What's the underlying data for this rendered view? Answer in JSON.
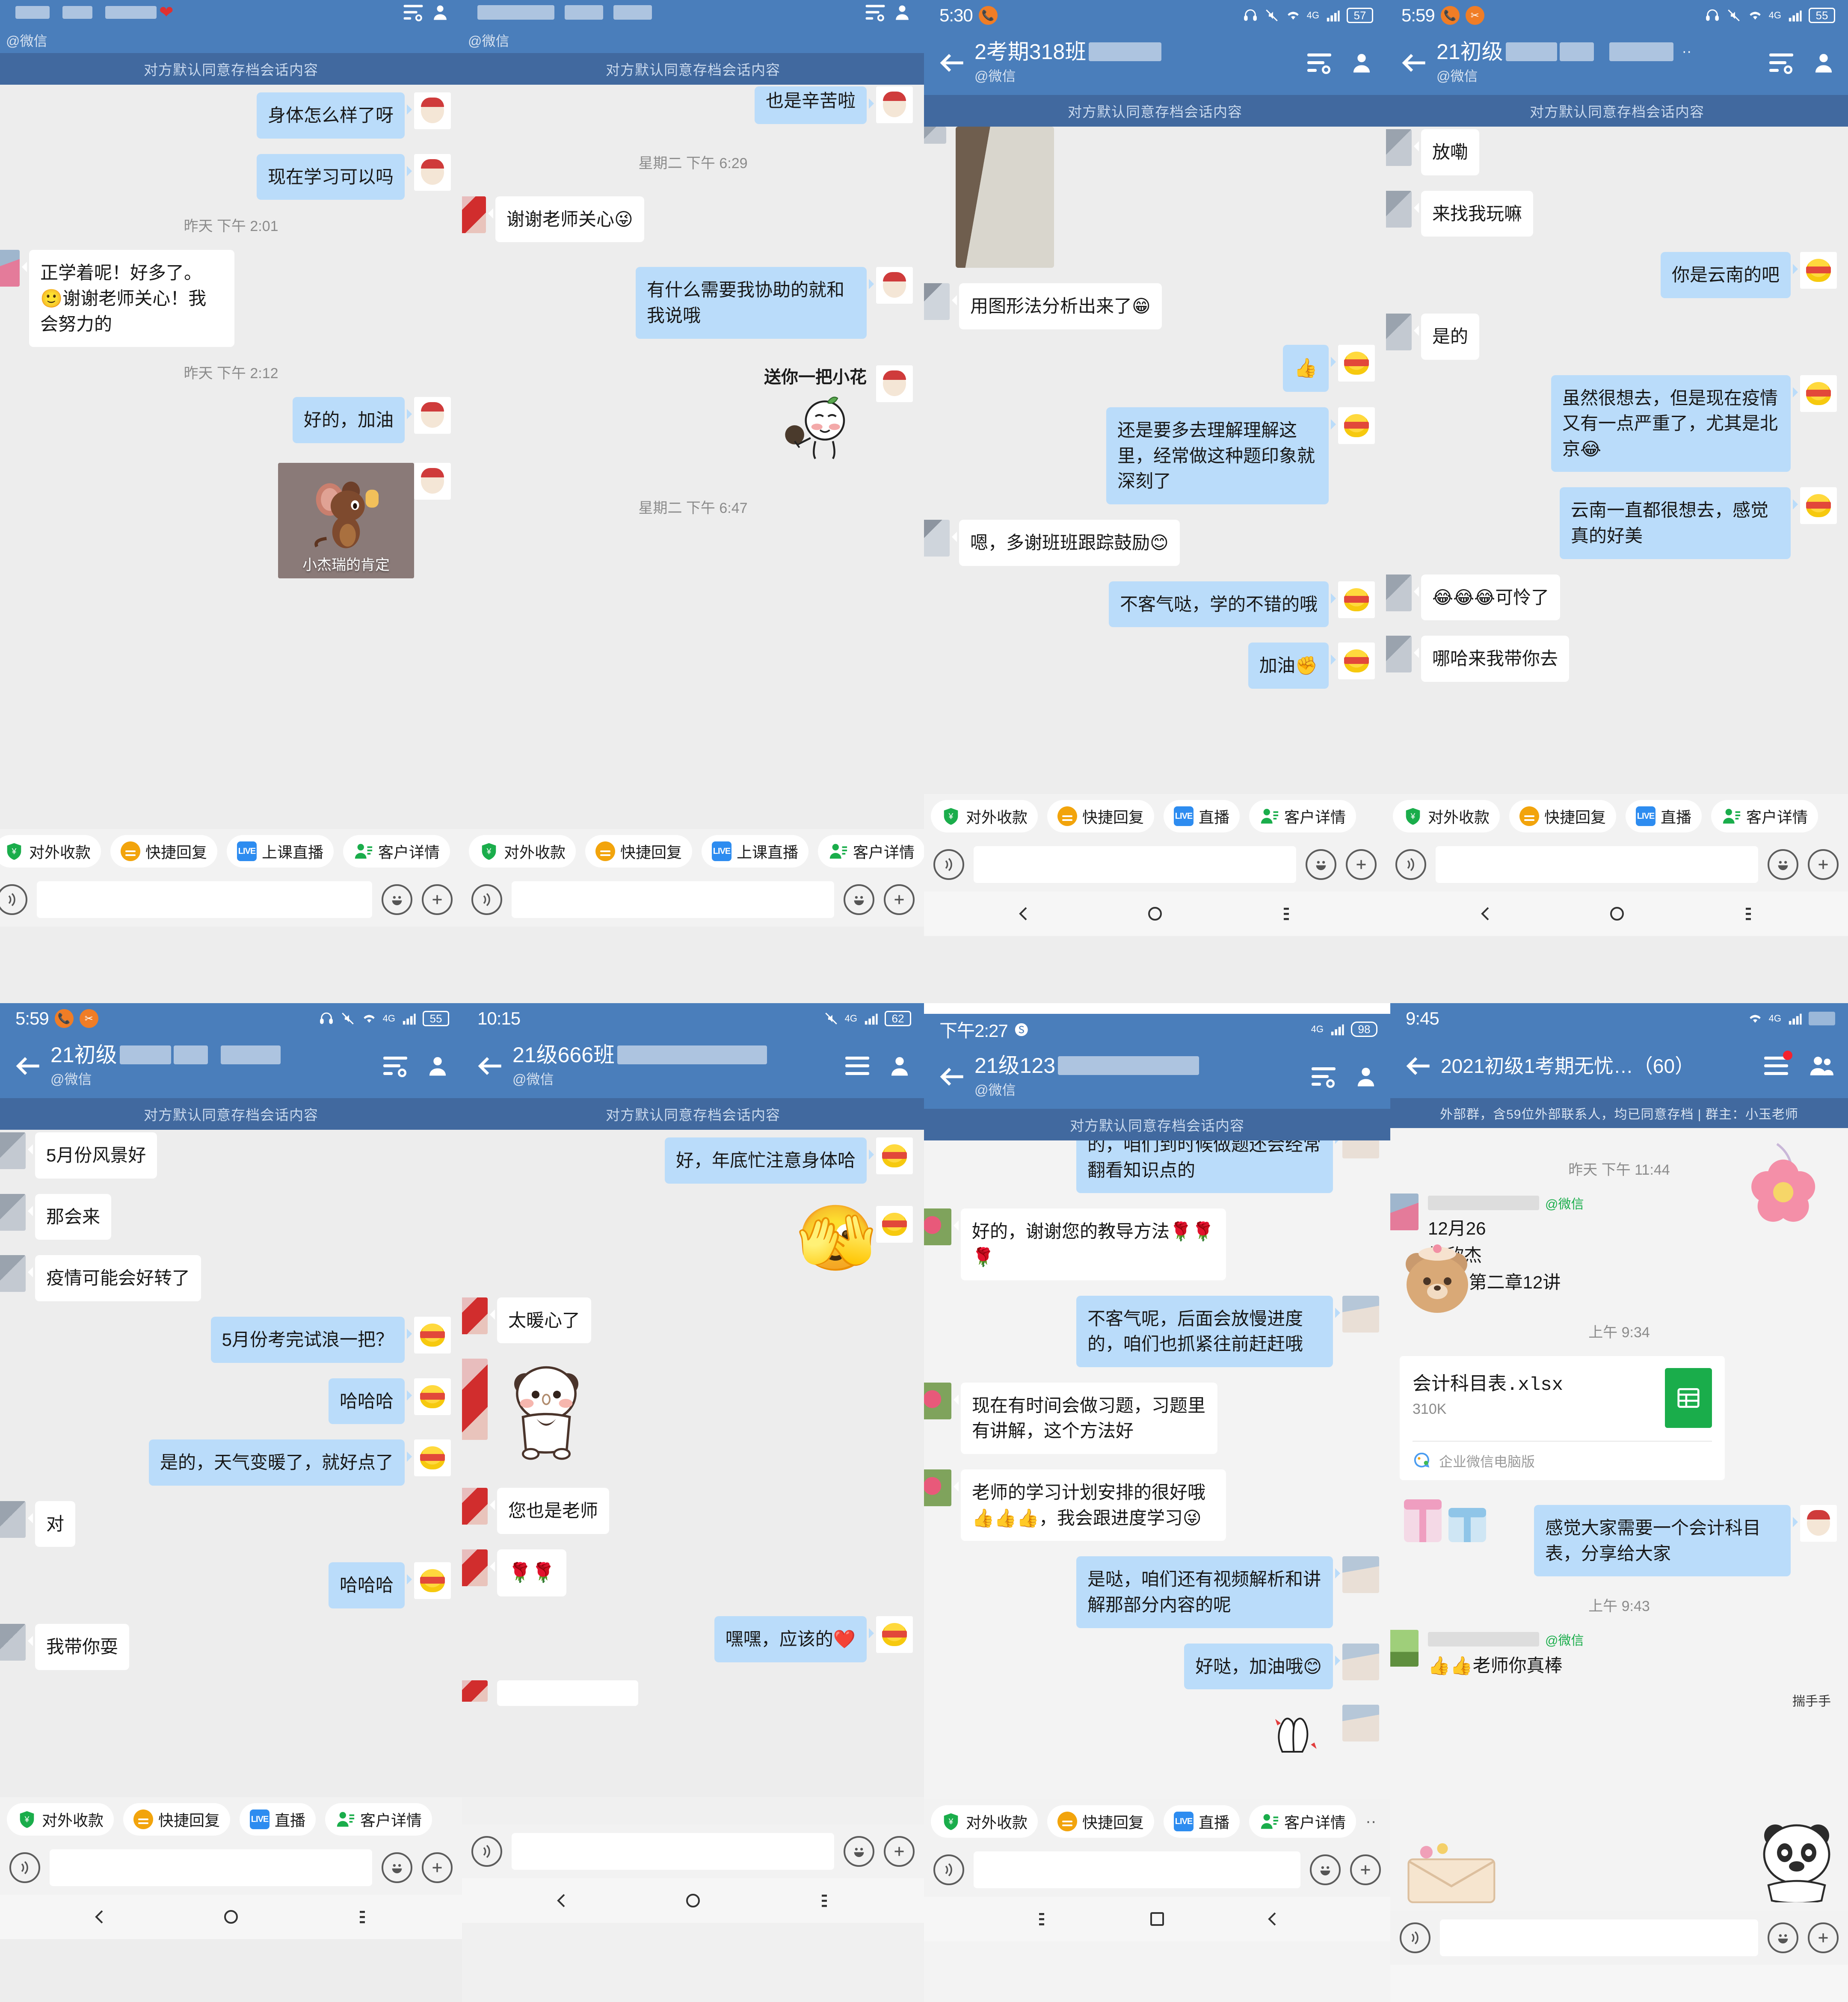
{
  "app": {
    "archive_notice": "对方默认同意存档会话内容",
    "wechat_handle": "@微信",
    "colors": {
      "header": "#4a7ebb",
      "archive_bar": "#41699f",
      "bubble_out": "#badcfa",
      "bubble_in": "#ffffff",
      "chat_bg": "#ededed"
    }
  },
  "quickbar": {
    "pay": "对外收款",
    "quick_reply": "快捷回复",
    "live_class": "上课直播",
    "live": "直播",
    "customer": "客户详情",
    "more": "··"
  },
  "panels": [
    {
      "id": "panel-1",
      "status": {
        "clock": "",
        "battery": "",
        "badges": []
      },
      "title": "",
      "subtitle": "@微信",
      "messages": [
        {
          "side": "out",
          "type": "text",
          "text": "身体怎么样了呀",
          "avatar": "doll"
        },
        {
          "side": "out",
          "type": "text",
          "text": "现在学习可以吗",
          "avatar": "doll"
        },
        {
          "type": "time",
          "text": "昨天  下午 2:01"
        },
        {
          "side": "in",
          "type": "text",
          "text": "正学着呢！好多了。🙂谢谢老师关心！我会努力的",
          "avatar": "photo"
        },
        {
          "type": "time",
          "text": "昨天  下午 2:12"
        },
        {
          "side": "out",
          "type": "text",
          "text": "好的，加油",
          "avatar": "doll"
        },
        {
          "side": "out",
          "type": "meme",
          "text": "小杰瑞的肯定",
          "avatar": "doll"
        }
      ],
      "quick": [
        "pay",
        "quick_reply",
        "live_class",
        "customer"
      ]
    },
    {
      "id": "panel-2",
      "status": {
        "clock": "",
        "battery": "",
        "badges": []
      },
      "title": "",
      "subtitle": "@微信",
      "messages": [
        {
          "side": "out",
          "type": "text",
          "text": "也是辛苦啦",
          "avatar": "doll"
        },
        {
          "type": "time",
          "text": "星期二  下午 6:29"
        },
        {
          "side": "in",
          "type": "text",
          "text": "谢谢老师关心😜",
          "avatar": "redblur"
        },
        {
          "side": "out",
          "type": "text",
          "text": "有什么需要我协助的就和我说哦",
          "avatar": "doll"
        },
        {
          "side": "out",
          "type": "sticker",
          "text": "送你一把小花",
          "avatar": "doll"
        },
        {
          "type": "time",
          "text": "星期二  下午 6:47"
        }
      ],
      "quick": [
        "pay",
        "quick_reply",
        "live_class",
        "customer"
      ]
    },
    {
      "id": "panel-3",
      "status": {
        "clock": "5:30",
        "battery": "57",
        "badges": [
          "call"
        ]
      },
      "title": "2考期318班",
      "subtitle": "@微信",
      "messages": [
        {
          "side": "in",
          "type": "image",
          "text": "",
          "avatar": "blur"
        },
        {
          "side": "in",
          "type": "text",
          "text": "用图形法分析出来了😁",
          "avatar": "blur2"
        },
        {
          "side": "out",
          "type": "emoji",
          "text": "👍",
          "avatar": "bee"
        },
        {
          "side": "out",
          "type": "text",
          "text": "还是要多去理解理解这里，经常做这种题印象就深刻了",
          "avatar": "bee"
        },
        {
          "side": "in",
          "type": "text",
          "text": "嗯，多谢班班跟踪鼓励😊",
          "avatar": "blur2"
        },
        {
          "side": "out",
          "type": "text",
          "text": "不客气哒，学的不错的哦",
          "avatar": "bee"
        },
        {
          "side": "out",
          "type": "text",
          "text": "加油✊",
          "avatar": "bee"
        }
      ],
      "quick": [
        "pay",
        "quick_reply",
        "live",
        "customer"
      ]
    },
    {
      "id": "panel-4",
      "status": {
        "clock": "5:59",
        "battery": "55",
        "badges": [
          "call",
          "crop"
        ]
      },
      "title": "21初级",
      "subtitle": "@微信",
      "messages": [
        {
          "side": "in",
          "type": "text",
          "text": "放嘞",
          "avatar": "blur"
        },
        {
          "side": "in",
          "type": "text",
          "text": "来找我玩嘛",
          "avatar": "blur"
        },
        {
          "side": "out",
          "type": "text",
          "text": "你是云南的吧",
          "avatar": "bee"
        },
        {
          "side": "in",
          "type": "text",
          "text": "是的",
          "avatar": "blur"
        },
        {
          "side": "out",
          "type": "text",
          "text": "虽然很想去，但是现在疫情又有一点严重了，尤其是北京😂",
          "avatar": "bee"
        },
        {
          "side": "out",
          "type": "text",
          "text": "云南一直都很想去，感觉真的好美",
          "avatar": "bee"
        },
        {
          "side": "in",
          "type": "text",
          "text": "😂😂😂可怜了",
          "avatar": "blur"
        },
        {
          "side": "in",
          "type": "text",
          "text": "哪哈来我带你去",
          "avatar": "blur"
        }
      ],
      "quick": [
        "pay",
        "quick_reply",
        "live",
        "customer"
      ]
    },
    {
      "id": "panel-5",
      "status": {
        "clock": "5:59",
        "battery": "55",
        "badges": [
          "call",
          "crop"
        ]
      },
      "title": "21初级",
      "subtitle": "@微信",
      "messages": [
        {
          "side": "in",
          "type": "text",
          "text": "5月份风景好",
          "avatar": "blur"
        },
        {
          "side": "in",
          "type": "text",
          "text": "那会来",
          "avatar": "blur"
        },
        {
          "side": "in",
          "type": "text",
          "text": "疫情可能会好转了",
          "avatar": "blur"
        },
        {
          "side": "out",
          "type": "text",
          "text": "5月份考完试浪一把？",
          "avatar": "bee"
        },
        {
          "side": "out",
          "type": "text",
          "text": "哈哈哈",
          "avatar": "bee"
        },
        {
          "side": "out",
          "type": "text",
          "text": "是的，天气变暖了，就好点了",
          "avatar": "bee"
        },
        {
          "side": "in",
          "type": "text",
          "text": "对",
          "avatar": "blur"
        },
        {
          "side": "out",
          "type": "text",
          "text": "哈哈哈",
          "avatar": "bee"
        },
        {
          "side": "in",
          "type": "text",
          "text": "我带你耍",
          "avatar": "blur"
        }
      ],
      "quick": [
        "pay",
        "quick_reply",
        "live",
        "customer"
      ]
    },
    {
      "id": "panel-6",
      "status": {
        "clock": "10:15",
        "battery": "62",
        "badges": []
      },
      "title": "21级666班",
      "subtitle": "@微信",
      "messages": [
        {
          "side": "out",
          "type": "text",
          "text": "好，年底忙注意身体哈",
          "avatar": "bee"
        },
        {
          "side": "out",
          "type": "emoji",
          "text": "🫣",
          "avatar": "bee"
        },
        {
          "side": "in",
          "type": "text",
          "text": "太暖心了",
          "avatar": "redblur"
        },
        {
          "side": "in",
          "type": "sticker",
          "text": "panda",
          "avatar": "redblur"
        },
        {
          "side": "in",
          "type": "text",
          "text": "您也是老师",
          "avatar": "redblur"
        },
        {
          "side": "in",
          "type": "text",
          "text": "🌹🌹",
          "avatar": "redblur"
        },
        {
          "side": "out",
          "type": "text",
          "text": "嘿嘿，应该的❤️",
          "avatar": "bee"
        }
      ],
      "quick": []
    },
    {
      "id": "panel-7",
      "status": {
        "clock": "下午2:27",
        "battery": "98",
        "badges": [
          "sogou"
        ]
      },
      "title": "21级123",
      "subtitle": "@微信",
      "messages": [
        {
          "side": "out",
          "type": "text",
          "text": "的，咱们到时候做题还会经常翻看知识点的",
          "avatar": "girl"
        },
        {
          "side": "in",
          "type": "text",
          "text": "好的，谢谢您的教导方法🌹🌹🌹",
          "avatar": "rose"
        },
        {
          "side": "out",
          "type": "text",
          "text": "不客气呢，后面会放慢进度的，咱们也抓紧往前赶赶哦",
          "avatar": "girl"
        },
        {
          "side": "in",
          "type": "text",
          "text": "现在有时间会做习题，习题里有讲解，这个方法好",
          "avatar": "rose"
        },
        {
          "side": "in",
          "type": "text",
          "text": "老师的学习计划安排的很好哦👍👍👍，我会跟进度学习😜",
          "avatar": "rose"
        },
        {
          "side": "out",
          "type": "text",
          "text": "是哒，咱们还有视频解析和讲解那部分内容的呢",
          "avatar": "girl"
        },
        {
          "side": "out",
          "type": "text",
          "text": "好哒，加油哦😊",
          "avatar": "girl"
        },
        {
          "side": "out",
          "type": "sticker",
          "text": "hands",
          "avatar": "girl"
        }
      ],
      "quick": [
        "pay",
        "quick_reply",
        "live",
        "customer",
        "more"
      ]
    },
    {
      "id": "panel-8",
      "status": {
        "clock": "9:45",
        "battery": "",
        "badges": []
      },
      "title": "2021初级1考期无忧…（60）",
      "subtitle": "",
      "group_notice": "外部群，含59位外部联系人，均已同意存档 | 群主：小玉老师",
      "messages": [
        {
          "type": "time",
          "text": "昨天  下午 11:44"
        },
        {
          "side": "in",
          "type": "card",
          "sender_tag": "@微信",
          "text": "12月26\n杨欣杰\n实务  第二章12讲",
          "avatar": "photo"
        },
        {
          "type": "time",
          "text": "上午 9:34"
        },
        {
          "side": "in",
          "type": "file",
          "filename": "会计科目表.xlsx",
          "filesize": "310K",
          "source": "企业微信电脑版",
          "avatar": "doll"
        },
        {
          "side": "out",
          "type": "text",
          "text": "感觉大家需要一个会计科目表，分享给大家",
          "avatar": "doll"
        },
        {
          "type": "time",
          "text": "上午 9:43"
        },
        {
          "side": "in",
          "type": "text",
          "sender_tag": "@微信",
          "text": "👍👍老师你真棒",
          "avatar": "tea"
        },
        {
          "side": "in",
          "type": "sticker",
          "text": "揣手手",
          "avatar": "tea"
        }
      ],
      "quick": []
    }
  ]
}
